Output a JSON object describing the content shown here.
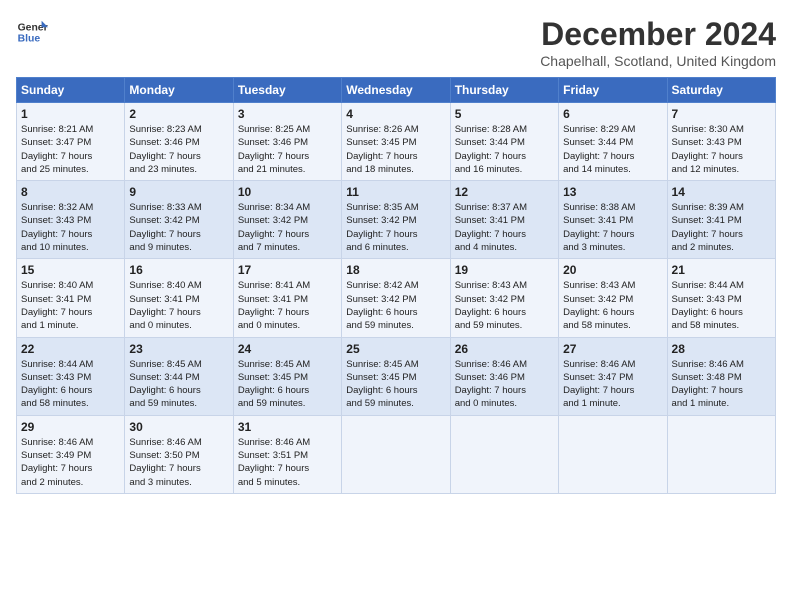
{
  "header": {
    "logo_line1": "General",
    "logo_line2": "Blue",
    "title": "December 2024",
    "location": "Chapelhall, Scotland, United Kingdom"
  },
  "days_of_week": [
    "Sunday",
    "Monday",
    "Tuesday",
    "Wednesday",
    "Thursday",
    "Friday",
    "Saturday"
  ],
  "weeks": [
    [
      {
        "day": "1",
        "lines": [
          "Sunrise: 8:21 AM",
          "Sunset: 3:47 PM",
          "Daylight: 7 hours",
          "and 25 minutes."
        ]
      },
      {
        "day": "2",
        "lines": [
          "Sunrise: 8:23 AM",
          "Sunset: 3:46 PM",
          "Daylight: 7 hours",
          "and 23 minutes."
        ]
      },
      {
        "day": "3",
        "lines": [
          "Sunrise: 8:25 AM",
          "Sunset: 3:46 PM",
          "Daylight: 7 hours",
          "and 21 minutes."
        ]
      },
      {
        "day": "4",
        "lines": [
          "Sunrise: 8:26 AM",
          "Sunset: 3:45 PM",
          "Daylight: 7 hours",
          "and 18 minutes."
        ]
      },
      {
        "day": "5",
        "lines": [
          "Sunrise: 8:28 AM",
          "Sunset: 3:44 PM",
          "Daylight: 7 hours",
          "and 16 minutes."
        ]
      },
      {
        "day": "6",
        "lines": [
          "Sunrise: 8:29 AM",
          "Sunset: 3:44 PM",
          "Daylight: 7 hours",
          "and 14 minutes."
        ]
      },
      {
        "day": "7",
        "lines": [
          "Sunrise: 8:30 AM",
          "Sunset: 3:43 PM",
          "Daylight: 7 hours",
          "and 12 minutes."
        ]
      }
    ],
    [
      {
        "day": "8",
        "lines": [
          "Sunrise: 8:32 AM",
          "Sunset: 3:43 PM",
          "Daylight: 7 hours",
          "and 10 minutes."
        ]
      },
      {
        "day": "9",
        "lines": [
          "Sunrise: 8:33 AM",
          "Sunset: 3:42 PM",
          "Daylight: 7 hours",
          "and 9 minutes."
        ]
      },
      {
        "day": "10",
        "lines": [
          "Sunrise: 8:34 AM",
          "Sunset: 3:42 PM",
          "Daylight: 7 hours",
          "and 7 minutes."
        ]
      },
      {
        "day": "11",
        "lines": [
          "Sunrise: 8:35 AM",
          "Sunset: 3:42 PM",
          "Daylight: 7 hours",
          "and 6 minutes."
        ]
      },
      {
        "day": "12",
        "lines": [
          "Sunrise: 8:37 AM",
          "Sunset: 3:41 PM",
          "Daylight: 7 hours",
          "and 4 minutes."
        ]
      },
      {
        "day": "13",
        "lines": [
          "Sunrise: 8:38 AM",
          "Sunset: 3:41 PM",
          "Daylight: 7 hours",
          "and 3 minutes."
        ]
      },
      {
        "day": "14",
        "lines": [
          "Sunrise: 8:39 AM",
          "Sunset: 3:41 PM",
          "Daylight: 7 hours",
          "and 2 minutes."
        ]
      }
    ],
    [
      {
        "day": "15",
        "lines": [
          "Sunrise: 8:40 AM",
          "Sunset: 3:41 PM",
          "Daylight: 7 hours",
          "and 1 minute."
        ]
      },
      {
        "day": "16",
        "lines": [
          "Sunrise: 8:40 AM",
          "Sunset: 3:41 PM",
          "Daylight: 7 hours",
          "and 0 minutes."
        ]
      },
      {
        "day": "17",
        "lines": [
          "Sunrise: 8:41 AM",
          "Sunset: 3:41 PM",
          "Daylight: 7 hours",
          "and 0 minutes."
        ]
      },
      {
        "day": "18",
        "lines": [
          "Sunrise: 8:42 AM",
          "Sunset: 3:42 PM",
          "Daylight: 6 hours",
          "and 59 minutes."
        ]
      },
      {
        "day": "19",
        "lines": [
          "Sunrise: 8:43 AM",
          "Sunset: 3:42 PM",
          "Daylight: 6 hours",
          "and 59 minutes."
        ]
      },
      {
        "day": "20",
        "lines": [
          "Sunrise: 8:43 AM",
          "Sunset: 3:42 PM",
          "Daylight: 6 hours",
          "and 58 minutes."
        ]
      },
      {
        "day": "21",
        "lines": [
          "Sunrise: 8:44 AM",
          "Sunset: 3:43 PM",
          "Daylight: 6 hours",
          "and 58 minutes."
        ]
      }
    ],
    [
      {
        "day": "22",
        "lines": [
          "Sunrise: 8:44 AM",
          "Sunset: 3:43 PM",
          "Daylight: 6 hours",
          "and 58 minutes."
        ]
      },
      {
        "day": "23",
        "lines": [
          "Sunrise: 8:45 AM",
          "Sunset: 3:44 PM",
          "Daylight: 6 hours",
          "and 59 minutes."
        ]
      },
      {
        "day": "24",
        "lines": [
          "Sunrise: 8:45 AM",
          "Sunset: 3:45 PM",
          "Daylight: 6 hours",
          "and 59 minutes."
        ]
      },
      {
        "day": "25",
        "lines": [
          "Sunrise: 8:45 AM",
          "Sunset: 3:45 PM",
          "Daylight: 6 hours",
          "and 59 minutes."
        ]
      },
      {
        "day": "26",
        "lines": [
          "Sunrise: 8:46 AM",
          "Sunset: 3:46 PM",
          "Daylight: 7 hours",
          "and 0 minutes."
        ]
      },
      {
        "day": "27",
        "lines": [
          "Sunrise: 8:46 AM",
          "Sunset: 3:47 PM",
          "Daylight: 7 hours",
          "and 1 minute."
        ]
      },
      {
        "day": "28",
        "lines": [
          "Sunrise: 8:46 AM",
          "Sunset: 3:48 PM",
          "Daylight: 7 hours",
          "and 1 minute."
        ]
      }
    ],
    [
      {
        "day": "29",
        "lines": [
          "Sunrise: 8:46 AM",
          "Sunset: 3:49 PM",
          "Daylight: 7 hours",
          "and 2 minutes."
        ]
      },
      {
        "day": "30",
        "lines": [
          "Sunrise: 8:46 AM",
          "Sunset: 3:50 PM",
          "Daylight: 7 hours",
          "and 3 minutes."
        ]
      },
      {
        "day": "31",
        "lines": [
          "Sunrise: 8:46 AM",
          "Sunset: 3:51 PM",
          "Daylight: 7 hours",
          "and 5 minutes."
        ]
      },
      {
        "day": "",
        "lines": []
      },
      {
        "day": "",
        "lines": []
      },
      {
        "day": "",
        "lines": []
      },
      {
        "day": "",
        "lines": []
      }
    ]
  ]
}
